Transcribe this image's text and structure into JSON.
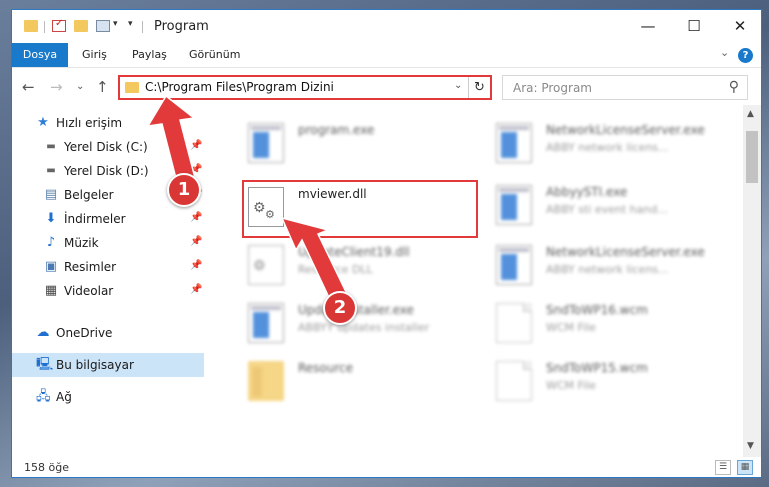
{
  "window": {
    "title": "Program"
  },
  "ribbon": {
    "tabs": [
      "Dosya",
      "Giriş",
      "Paylaş",
      "Görünüm"
    ]
  },
  "nav": {
    "address": "C:\\Program Files\\Program Dizini",
    "search_placeholder": "Ara: Program"
  },
  "sidebar": {
    "quick_access": "Hızlı erişim",
    "items": [
      {
        "label": "Yerel Disk (C:)"
      },
      {
        "label": "Yerel Disk (D:)"
      },
      {
        "label": "Belgeler"
      },
      {
        "label": "İndirmeler"
      },
      {
        "label": "Müzik"
      },
      {
        "label": "Resimler"
      },
      {
        "label": "Videolar"
      }
    ],
    "onedrive": "OneDrive",
    "this_pc": "Bu bilgisayar",
    "network": "Ağ"
  },
  "files": {
    "left": [
      {
        "name": "program.exe",
        "desc": ""
      },
      {
        "name": "mviewer.dll",
        "desc": ""
      },
      {
        "name": "UpdateClient19.dll",
        "desc": "Resource DLL"
      },
      {
        "name": "UpdateInstaller.exe",
        "desc": "ABBYY updates installer"
      },
      {
        "name": "Resource",
        "desc": ""
      }
    ],
    "right": [
      {
        "name": "NetworkLicenseServer.exe",
        "desc": "ABBY network licens..."
      },
      {
        "name": "AbbyySTI.exe",
        "desc": "ABBY sti event hand..."
      },
      {
        "name": "NetworkLicenseServer.exe",
        "desc": "ABBY network licens..."
      },
      {
        "name": "SndToWP16.wcm",
        "desc": "WCM File"
      },
      {
        "name": "SndToWP15.wcm",
        "desc": "WCM File"
      }
    ]
  },
  "status": {
    "count": "158 öğe"
  },
  "annotations": {
    "step1": "1",
    "step2": "2"
  },
  "colors": {
    "accent": "#1979ca",
    "highlight": "#e23a3a",
    "selected": "#cce4f7"
  }
}
